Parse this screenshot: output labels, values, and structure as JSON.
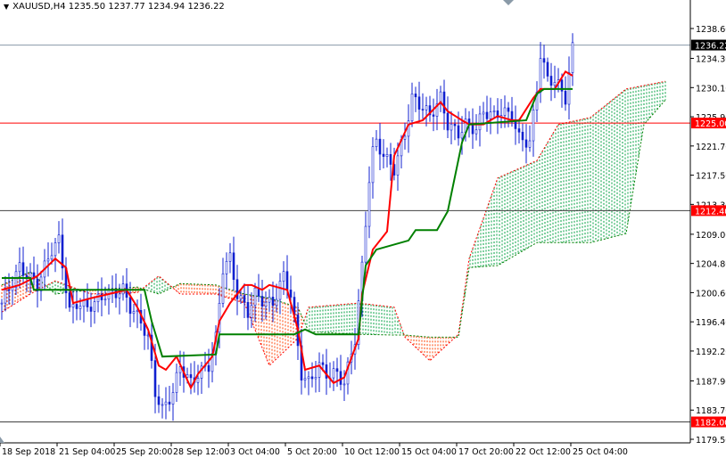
{
  "header": {
    "symbol": "XAUUSD,H4",
    "open": "1235.50",
    "high": "1237.77",
    "low": "1234.94",
    "close": "1236.22"
  },
  "chart_data": {
    "type": "candlestick",
    "title": "XAUUSD,H4",
    "ylim": [
      1179.5,
      1238.6
    ],
    "y_ticks": [
      "1238.60",
      "1234.30",
      "1230.10",
      "1225.90",
      "1221.70",
      "1217.50",
      "1213.30",
      "1209.00",
      "1204.80",
      "1200.60",
      "1196.40",
      "1192.20",
      "1187.90",
      "1183.70",
      "1179.50"
    ],
    "x_ticks": [
      {
        "bar": 0,
        "label": "18 Sep 2018"
      },
      {
        "bar": 16,
        "label": "21 Sep 04:00"
      },
      {
        "bar": 32,
        "label": "25 Sep 20:00"
      },
      {
        "bar": 48,
        "label": "28 Sep 12:00"
      },
      {
        "bar": 64,
        "label": "3 Oct 04:00"
      },
      {
        "bar": 80,
        "label": "5 Oct 20:00"
      },
      {
        "bar": 96,
        "label": "10 Oct 12:00"
      },
      {
        "bar": 112,
        "label": "15 Oct 04:00"
      },
      {
        "bar": 128,
        "label": "17 Oct 20:00"
      },
      {
        "bar": 144,
        "label": "22 Oct 12:00"
      },
      {
        "bar": 160,
        "label": "25 Oct 04:00"
      }
    ],
    "price_lines": [
      {
        "label": "1236.22",
        "price": 1236.22,
        "color": "#8a9aa8",
        "tag": "#000000"
      },
      {
        "label": "1225.00",
        "price": 1225.0,
        "color": "#ff0000",
        "tag": "#ff0000"
      },
      {
        "label": "1212.40",
        "price": 1212.4,
        "color": "#404040",
        "tag": "#ff0000"
      },
      {
        "label": "1182.00",
        "price": 1182.0,
        "color": "#404040",
        "tag": "#ff0000"
      }
    ],
    "close_points": [
      [
        0,
        1199.1
      ],
      [
        5,
        1204.2
      ],
      [
        10,
        1201.7
      ],
      [
        14,
        1206.8
      ],
      [
        16,
        1208.1
      ],
      [
        19,
        1197.8
      ],
      [
        21,
        1199.1
      ],
      [
        24,
        1198.5
      ],
      [
        26,
        1199.1
      ],
      [
        29,
        1200.4
      ],
      [
        31,
        1200.4
      ],
      [
        34,
        1201.0
      ],
      [
        36,
        1198.5
      ],
      [
        39,
        1196.5
      ],
      [
        41,
        1194.0
      ],
      [
        43,
        1186.3
      ],
      [
        45,
        1183.7
      ],
      [
        48,
        1186.3
      ],
      [
        50,
        1190.1
      ],
      [
        53,
        1187.6
      ],
      [
        55,
        1188.9
      ],
      [
        58,
        1190.1
      ],
      [
        60,
        1194.0
      ],
      [
        62,
        1204.2
      ],
      [
        64,
        1205.5
      ],
      [
        66,
        1200.4
      ],
      [
        69,
        1197.8
      ],
      [
        71,
        1200.4
      ],
      [
        74,
        1199.1
      ],
      [
        76,
        1199.1
      ],
      [
        79,
        1203.0
      ],
      [
        81,
        1200.4
      ],
      [
        84,
        1188.9
      ],
      [
        86,
        1187.6
      ],
      [
        89,
        1190.1
      ],
      [
        91,
        1188.9
      ],
      [
        94,
        1188.9
      ],
      [
        96,
        1187.6
      ],
      [
        99,
        1194.0
      ],
      [
        101,
        1204.2
      ],
      [
        103,
        1217.1
      ],
      [
        104,
        1220.9
      ],
      [
        105,
        1222.2
      ],
      [
        108,
        1219.6
      ],
      [
        110,
        1218.4
      ],
      [
        113,
        1223.5
      ],
      [
        115,
        1228.6
      ],
      [
        118,
        1227.3
      ],
      [
        120,
        1226.0
      ],
      [
        123,
        1228.6
      ],
      [
        125,
        1224.8
      ],
      [
        128,
        1223.5
      ],
      [
        130,
        1224.8
      ],
      [
        133,
        1224.1
      ],
      [
        135,
        1226.7
      ],
      [
        138,
        1226.0
      ],
      [
        140,
        1226.7
      ],
      [
        143,
        1226.0
      ],
      [
        145,
        1222.8
      ],
      [
        148,
        1222.2
      ],
      [
        150,
        1229.9
      ],
      [
        151,
        1235.0
      ],
      [
        153,
        1231.2
      ],
      [
        155,
        1231.2
      ],
      [
        158,
        1228.6
      ],
      [
        160,
        1235.7
      ]
    ],
    "series": [
      {
        "name": "Tenkan-sen",
        "color": "#ff0000",
        "points": [
          [
            0,
            1201.0
          ],
          [
            5,
            1201.7
          ],
          [
            10,
            1203.0
          ],
          [
            15,
            1205.5
          ],
          [
            18,
            1204.2
          ],
          [
            20,
            1199.1
          ],
          [
            25,
            1199.8
          ],
          [
            30,
            1200.4
          ],
          [
            35,
            1201.0
          ],
          [
            38,
            1198.5
          ],
          [
            41,
            1195.3
          ],
          [
            44,
            1190.1
          ],
          [
            46,
            1189.5
          ],
          [
            49,
            1191.4
          ],
          [
            53,
            1186.9
          ],
          [
            55,
            1188.9
          ],
          [
            59,
            1191.4
          ],
          [
            61,
            1196.5
          ],
          [
            64,
            1199.1
          ],
          [
            68,
            1201.7
          ],
          [
            70,
            1201.7
          ],
          [
            73,
            1201.0
          ],
          [
            75,
            1201.7
          ],
          [
            80,
            1201.0
          ],
          [
            83,
            1195.3
          ],
          [
            85,
            1189.5
          ],
          [
            89,
            1190.1
          ],
          [
            93,
            1187.6
          ],
          [
            96,
            1188.4
          ],
          [
            100,
            1194.0
          ],
          [
            101,
            1200.4
          ],
          [
            104,
            1206.8
          ],
          [
            108,
            1209.4
          ],
          [
            110,
            1220.3
          ],
          [
            114,
            1224.8
          ],
          [
            118,
            1225.4
          ],
          [
            123,
            1228.0
          ],
          [
            125,
            1226.7
          ],
          [
            129,
            1225.4
          ],
          [
            131,
            1224.8
          ],
          [
            135,
            1224.8
          ],
          [
            139,
            1226.0
          ],
          [
            143,
            1225.4
          ],
          [
            145,
            1225.4
          ],
          [
            149,
            1228.6
          ],
          [
            151,
            1229.9
          ],
          [
            155,
            1229.9
          ],
          [
            158,
            1232.4
          ],
          [
            160,
            1231.8
          ]
        ]
      },
      {
        "name": "Kijun-sen",
        "color": "#008000",
        "points": [
          [
            0,
            1202.7
          ],
          [
            8,
            1202.7
          ],
          [
            9,
            1201.0
          ],
          [
            40,
            1201.0
          ],
          [
            42,
            1196.5
          ],
          [
            45,
            1191.4
          ],
          [
            60,
            1191.7
          ],
          [
            61,
            1194.6
          ],
          [
            82,
            1194.6
          ],
          [
            85,
            1195.3
          ],
          [
            88,
            1194.6
          ],
          [
            100,
            1194.6
          ],
          [
            102,
            1204.5
          ],
          [
            105,
            1206.8
          ],
          [
            114,
            1208.1
          ],
          [
            116,
            1209.6
          ],
          [
            122,
            1209.6
          ],
          [
            125,
            1212.3
          ],
          [
            129,
            1222.2
          ],
          [
            131,
            1224.8
          ],
          [
            147,
            1225.4
          ],
          [
            150,
            1229.2
          ],
          [
            152,
            1229.9
          ],
          [
            160,
            1229.9
          ]
        ]
      },
      {
        "name": "Senkou Span A",
        "color": "#ff0000",
        "points": [
          [
            0,
            1197.8
          ],
          [
            8,
            1200.4
          ],
          [
            15,
            1202.3
          ],
          [
            25,
            1200.4
          ],
          [
            38,
            1200.6
          ],
          [
            44,
            1203.0
          ],
          [
            50,
            1200.4
          ],
          [
            60,
            1200.4
          ],
          [
            68,
            1199.1
          ],
          [
            75,
            1190.1
          ],
          [
            83,
            1194.0
          ],
          [
            86,
            1198.5
          ],
          [
            100,
            1199.1
          ],
          [
            110,
            1198.5
          ],
          [
            113,
            1194.2
          ],
          [
            120,
            1190.8
          ],
          [
            128,
            1194.6
          ],
          [
            131,
            1205.5
          ],
          [
            139,
            1217.1
          ],
          [
            150,
            1219.6
          ],
          [
            156,
            1224.8
          ],
          [
            165,
            1225.8
          ],
          [
            175,
            1229.9
          ],
          [
            180,
            1230.4
          ],
          [
            186,
            1231.0
          ]
        ]
      },
      {
        "name": "Senkou Span B",
        "color": "#008000",
        "points": [
          [
            0,
            1201.7
          ],
          [
            8,
            1203.6
          ],
          [
            15,
            1200.4
          ],
          [
            25,
            1201.0
          ],
          [
            38,
            1201.4
          ],
          [
            44,
            1200.4
          ],
          [
            50,
            1201.9
          ],
          [
            60,
            1201.7
          ],
          [
            68,
            1200.4
          ],
          [
            75,
            1199.8
          ],
          [
            83,
            1198.5
          ],
          [
            86,
            1195.0
          ],
          [
            100,
            1194.6
          ],
          [
            110,
            1194.5
          ],
          [
            113,
            1194.5
          ],
          [
            120,
            1194.2
          ],
          [
            128,
            1194.2
          ],
          [
            131,
            1204.2
          ],
          [
            139,
            1204.5
          ],
          [
            150,
            1207.8
          ],
          [
            156,
            1207.8
          ],
          [
            165,
            1207.8
          ],
          [
            175,
            1209.1
          ],
          [
            180,
            1224.8
          ],
          [
            186,
            1228.3
          ]
        ]
      }
    ]
  }
}
